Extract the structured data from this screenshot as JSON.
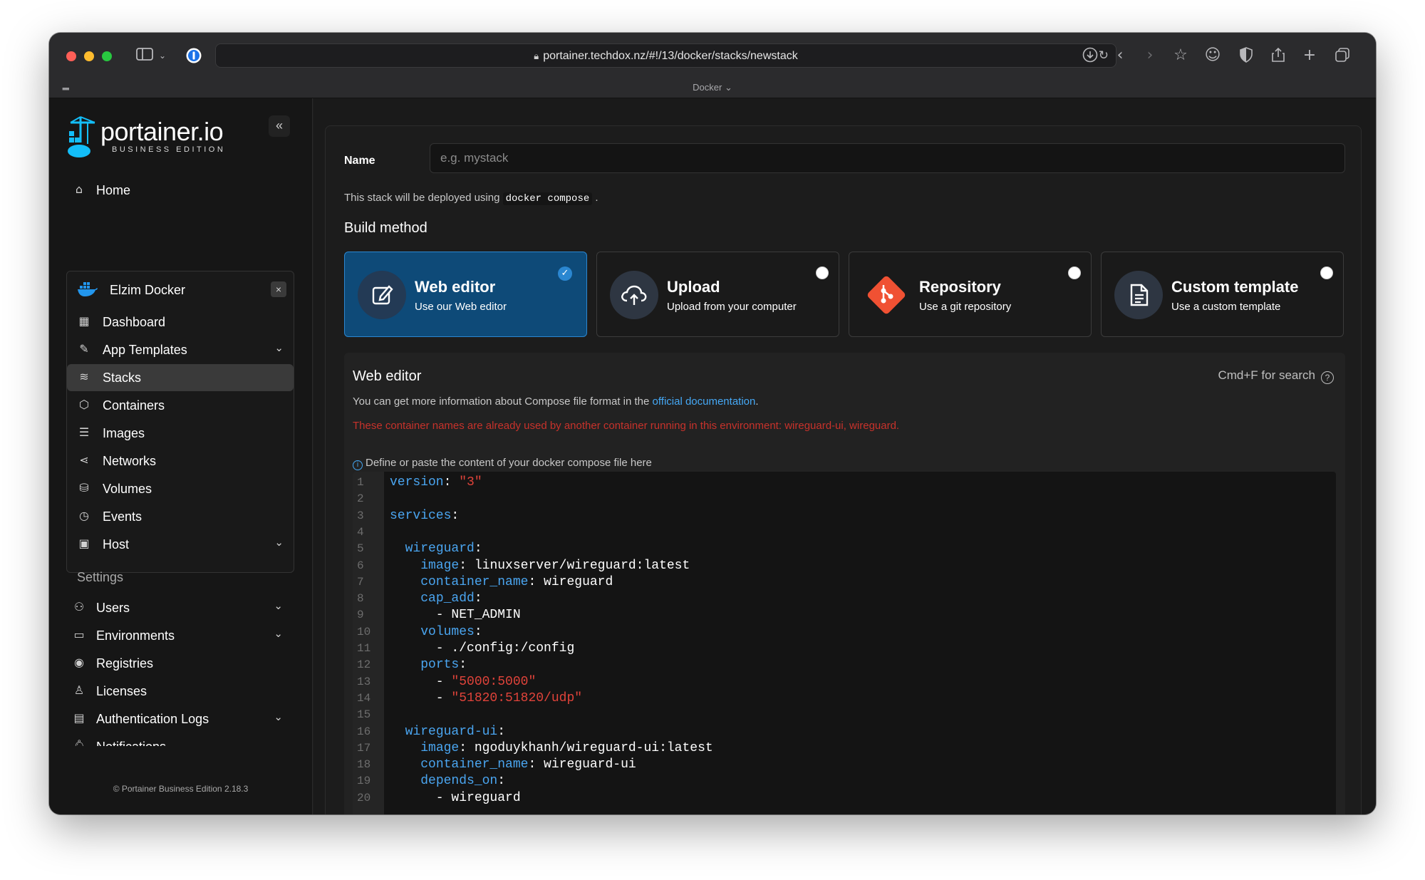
{
  "browser": {
    "url": "portainer.techdox.nz/#!/13/docker/stacks/newstack",
    "tab_title": "Docker ⌄"
  },
  "sidebar": {
    "logo_name": "portainer.io",
    "logo_sub": "BUSINESS EDITION",
    "collapse": "«",
    "home": "Home",
    "environment": {
      "name": "Elzim Docker",
      "close": "×",
      "items": [
        {
          "label": "Dashboard",
          "icon": "dashboard-icon"
        },
        {
          "label": "App Templates",
          "icon": "edit-icon",
          "expandable": true
        },
        {
          "label": "Stacks",
          "icon": "layers-icon",
          "active": true
        },
        {
          "label": "Containers",
          "icon": "box-icon"
        },
        {
          "label": "Images",
          "icon": "list-icon"
        },
        {
          "label": "Networks",
          "icon": "share-icon"
        },
        {
          "label": "Volumes",
          "icon": "database-icon"
        },
        {
          "label": "Events",
          "icon": "clock-icon"
        },
        {
          "label": "Host",
          "icon": "server-icon",
          "expandable": true
        }
      ]
    },
    "settings_title": "Settings",
    "settings_items": [
      {
        "label": "Users",
        "icon": "users-icon",
        "expandable": true
      },
      {
        "label": "Environments",
        "icon": "hdd-icon",
        "expandable": true
      },
      {
        "label": "Registries",
        "icon": "radio-icon"
      },
      {
        "label": "Licenses",
        "icon": "award-icon"
      },
      {
        "label": "Authentication Logs",
        "icon": "file-text-icon",
        "expandable": true
      },
      {
        "label": "Notifications",
        "icon": "bell-icon"
      }
    ],
    "footer": "© Portainer Business Edition 2.18.3"
  },
  "form": {
    "name_label": "Name",
    "name_placeholder": "e.g. mystack",
    "deploy_note_prefix": "This stack will be deployed using",
    "deploy_note_code": "docker compose",
    "deploy_note_suffix": ".",
    "build_title": "Build method",
    "build_methods": [
      {
        "title": "Web editor",
        "subtitle": "Use our Web editor",
        "icon": "edit-icon",
        "selected": true
      },
      {
        "title": "Upload",
        "subtitle": "Upload from your computer",
        "icon": "upload-cloud-icon",
        "selected": false
      },
      {
        "title": "Repository",
        "subtitle": "Use a git repository",
        "icon": "git-icon",
        "selected": false
      },
      {
        "title": "Custom template",
        "subtitle": "Use a custom template",
        "icon": "file-text-icon",
        "selected": false
      }
    ]
  },
  "editor": {
    "title": "Web editor",
    "search_hint": "Cmd+F for search",
    "info_prefix": "You can get more information about Compose file format in the",
    "info_link": "official documentation",
    "info_suffix": ".",
    "warning": "These container names are already used by another container running in this environment: wireguard-ui, wireguard.",
    "hint": "Define or paste the content of your docker compose file here",
    "lines": [
      "version: \"3\"",
      "",
      "services:",
      "",
      "  wireguard:",
      "    image: linuxserver/wireguard:latest",
      "    container_name: wireguard",
      "    cap_add:",
      "      - NET_ADMIN",
      "    volumes:",
      "      - ./config:/config",
      "    ports:",
      "      - \"5000:5000\"",
      "      - \"51820:51820/udp\"",
      "",
      "  wireguard-ui:",
      "    image: ngoduykhanh/wireguard-ui:latest",
      "    container_name: wireguard-ui",
      "    depends_on:",
      "      - wireguard"
    ]
  },
  "colors": {
    "accent": "#2b87d1",
    "selected_card": "#0e4a78",
    "warning": "#c7322b",
    "link": "#45a8f5",
    "yaml_key": "#4aa5f0",
    "yaml_string": "#e0433a"
  }
}
